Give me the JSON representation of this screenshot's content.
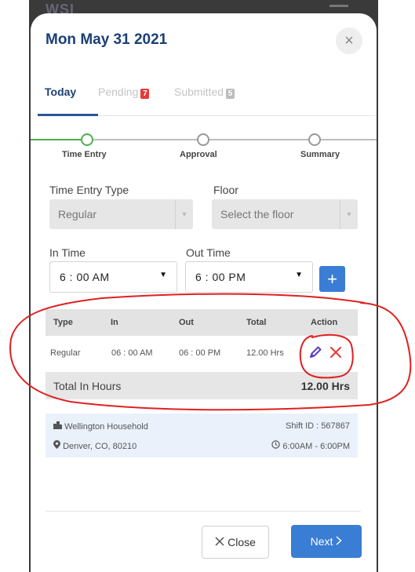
{
  "background": {
    "logo_text": "WSI"
  },
  "modal": {
    "title": "Mon May 31 2021",
    "close_glyph": "×"
  },
  "tabs": [
    {
      "label": "Today",
      "badge": ""
    },
    {
      "label": "Pending",
      "badge": "7"
    },
    {
      "label": "Submitted",
      "badge": "5"
    }
  ],
  "stepper": {
    "steps": [
      "Time Entry",
      "Approval",
      "Summary"
    ],
    "active_index": 0,
    "active_color": "#4caf50"
  },
  "form": {
    "entry_type_label": "Time Entry Type",
    "entry_type_value": "Regular",
    "floor_label": "Floor",
    "floor_placeholder": "Select the floor",
    "in_time_label": "In Time",
    "in_time_value": "6 : 00 AM",
    "out_time_label": "Out Time",
    "out_time_value": "6 : 00 PM",
    "add_glyph": "+"
  },
  "table": {
    "headers": [
      "Type",
      "In",
      "Out",
      "Total",
      "Action"
    ],
    "rows": [
      {
        "type": "Regular",
        "in": "06 : 00 AM",
        "out": "06 : 00 PM",
        "total": "12.00 Hrs"
      }
    ],
    "total_label": "Total In Hours",
    "total_value": "12.00 Hrs"
  },
  "location": {
    "name": "Wellington Household",
    "shift": "Shift ID : 567867",
    "address": "Denver, CO, 80210",
    "hours": "6:00AM - 6:00PM"
  },
  "footer": {
    "close_label": "Close",
    "next_label": "Next"
  },
  "colors": {
    "brand": "#1c3f74",
    "primary_button": "#3a7dd4",
    "annotation": "#e02020",
    "delete_icon": "#e53935",
    "edit_icon": "#5b3ec9"
  }
}
